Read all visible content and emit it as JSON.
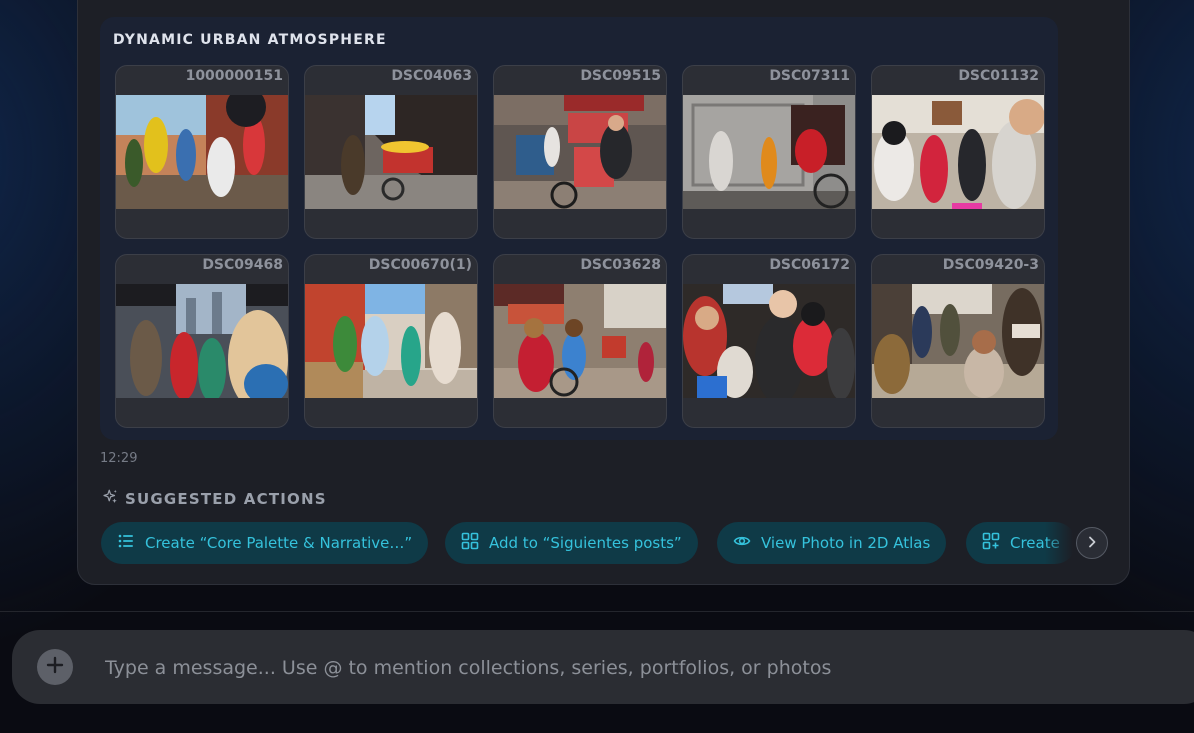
{
  "collection": {
    "title": "DYNAMIC URBAN ATMOSPHERE",
    "photos": [
      {
        "label": "1000000151"
      },
      {
        "label": "DSC04063"
      },
      {
        "label": "DSC09515"
      },
      {
        "label": "DSC07311"
      },
      {
        "label": "DSC01132"
      },
      {
        "label": "DSC09468"
      },
      {
        "label": "DSC00670(1)"
      },
      {
        "label": "DSC03628"
      },
      {
        "label": "DSC06172"
      },
      {
        "label": "DSC09420-3"
      }
    ]
  },
  "message": {
    "timestamp": "12:29"
  },
  "suggested_actions": {
    "title": "SUGGESTED ACTIONS",
    "icon": "sparkles-icon",
    "chips": [
      {
        "label": "Create “Core Palette & Narrative…”",
        "icon": "list-icon"
      },
      {
        "label": "Add to “Siguientes posts”",
        "icon": "grid-icon"
      },
      {
        "label": "View Photo in 2D Atlas",
        "icon": "eye-icon"
      },
      {
        "label": "Create",
        "icon": "grid-plus-icon"
      }
    ],
    "scroll_icon": "chevron-right-icon"
  },
  "composer": {
    "placeholder": "Type a message... Use @ to mention collections, series, portfolios, or photos",
    "attach_icon": "plus-icon"
  },
  "colors": {
    "accent": "#35c2dc",
    "chip_background": "#0f3a47",
    "panel": "#1d1f26",
    "collection_background": "#1b2233"
  }
}
